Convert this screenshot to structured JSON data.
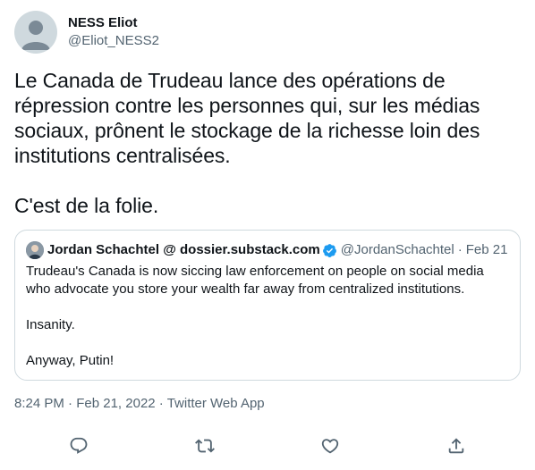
{
  "author": {
    "display_name": "NESS Eliot",
    "handle": "@Eliot_NESS2"
  },
  "tweet": {
    "text": "Le Canada de Trudeau lance des opérations de répression contre les personnes qui, sur les médias sociaux, prônent le stockage de la richesse loin des institutions centralisées.\n\nC'est de la folie."
  },
  "quote": {
    "display_name": "Jordan Schachtel @ dossier.substack.com",
    "handle": "@JordanSchachtel",
    "separator": "·",
    "date": "Feb 21",
    "text": "Trudeau's Canada is now siccing law enforcement on people on social media who advocate you store your wealth far away from centralized institutions.\n\nInsanity.\n\nAnyway, Putin!"
  },
  "meta": {
    "time": "8:24 PM",
    "separator1": "·",
    "date": "Feb 21, 2022",
    "separator2": "·",
    "source": "Twitter Web App"
  },
  "actions": {
    "icons": [
      "reply-icon",
      "retweet-icon",
      "like-icon",
      "share-icon"
    ]
  },
  "colors": {
    "text": "#0f1419",
    "secondary": "#536471",
    "border": "#cfd9de",
    "verified": "#1d9bf0"
  }
}
